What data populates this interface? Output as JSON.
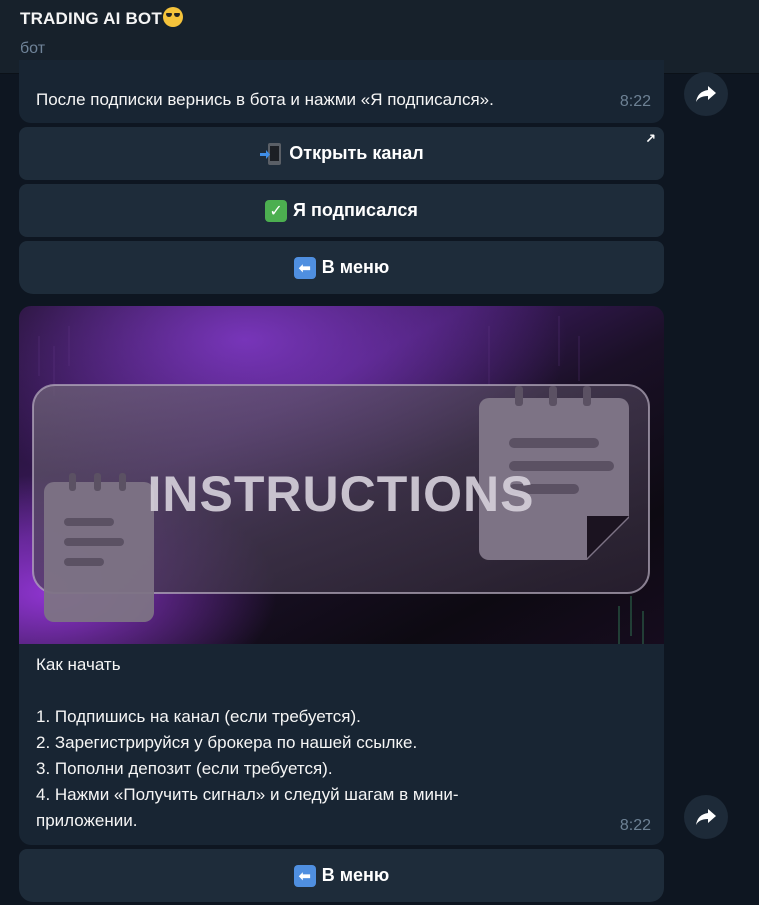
{
  "header": {
    "title": "TRADING AI BOT",
    "subtitle": "бот"
  },
  "message1": {
    "text": "После подписки вернись в бота и нажми «Я подписался».",
    "time": "8:22"
  },
  "keyboard1": {
    "open_channel_label": "Открыть канал",
    "subscribed_label": "Я подписался",
    "menu_label": "В меню"
  },
  "message2": {
    "image_text": "INSTRUCTIONS",
    "title": "Как начать",
    "steps": [
      "1. Подпишись на канал (если требуется).",
      "2. Зарегистрируйся у брокера по нашей ссылке.",
      "3. Пополни депозит (если требуется).",
      "4. Нажми «Получить сигнал» и следуй шагам в мини-",
      "приложении."
    ],
    "time": "8:22"
  },
  "keyboard2": {
    "menu_label": "В меню"
  },
  "icons": {
    "header_emoji": "smiling-face-with-sunglasses",
    "open_channel": "mobile-phone-with-arrow",
    "subscribed": "check-mark-button",
    "menu": "left-arrow-button",
    "share": "share-arrow"
  },
  "colors": {
    "background": "#0e1621",
    "header": "#17212b",
    "bubble": "#182533",
    "button": "#1e2c3a",
    "timestamp": "#6d8194"
  }
}
